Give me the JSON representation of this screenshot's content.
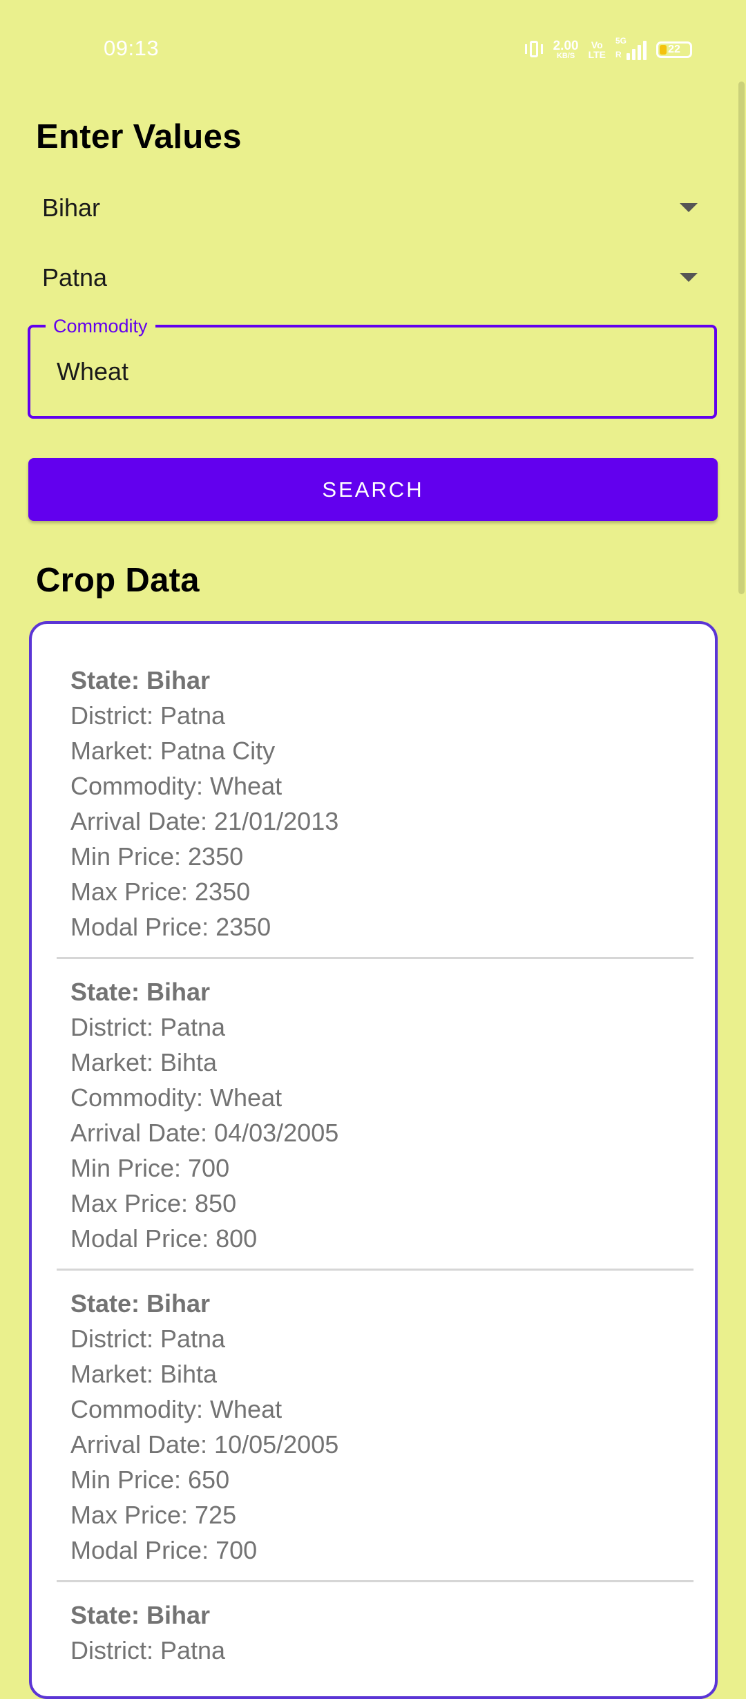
{
  "status_bar": {
    "time": "09:13",
    "net_speed": "2.00",
    "net_speed_unit": "KB/S",
    "volte_top": "Vo",
    "volte_bottom": "LTE",
    "network_type": "5G",
    "network_sub": "R",
    "battery_level": "22",
    "icons": [
      "vibrate-icon",
      "volte-icon",
      "signal-icon",
      "battery-icon"
    ]
  },
  "form": {
    "title": "Enter Values",
    "state_value": "Bihar",
    "district_value": "Patna",
    "commodity_label": "Commodity",
    "commodity_value": "Wheat",
    "search_label": "SEARCH"
  },
  "results": {
    "title": "Crop Data",
    "records": [
      {
        "state": "State: Bihar",
        "district": "District: Patna",
        "market": "Market: Patna City",
        "commodity": "Commodity: Wheat",
        "arrival_date": "Arrival Date: 21/01/2013",
        "min_price": "Min Price: 2350",
        "max_price": "Max Price: 2350",
        "modal_price": "Modal Price: 2350"
      },
      {
        "state": "State: Bihar",
        "district": "District: Patna",
        "market": "Market: Bihta",
        "commodity": "Commodity: Wheat",
        "arrival_date": "Arrival Date: 04/03/2005",
        "min_price": "Min Price: 700",
        "max_price": "Max Price: 850",
        "modal_price": "Modal Price: 800"
      },
      {
        "state": "State: Bihar",
        "district": "District: Patna",
        "market": "Market: Bihta",
        "commodity": "Commodity: Wheat",
        "arrival_date": "Arrival Date: 10/05/2005",
        "min_price": "Min Price: 650",
        "max_price": "Max Price: 725",
        "modal_price": "Modal Price: 700"
      },
      {
        "state": "State: Bihar",
        "district": "District: Patna"
      }
    ]
  },
  "colors": {
    "background": "#eaf08d",
    "accent": "#6200ee",
    "card_border": "#5b35d5",
    "record_text": "#737373",
    "battery": "#f4c20d"
  }
}
